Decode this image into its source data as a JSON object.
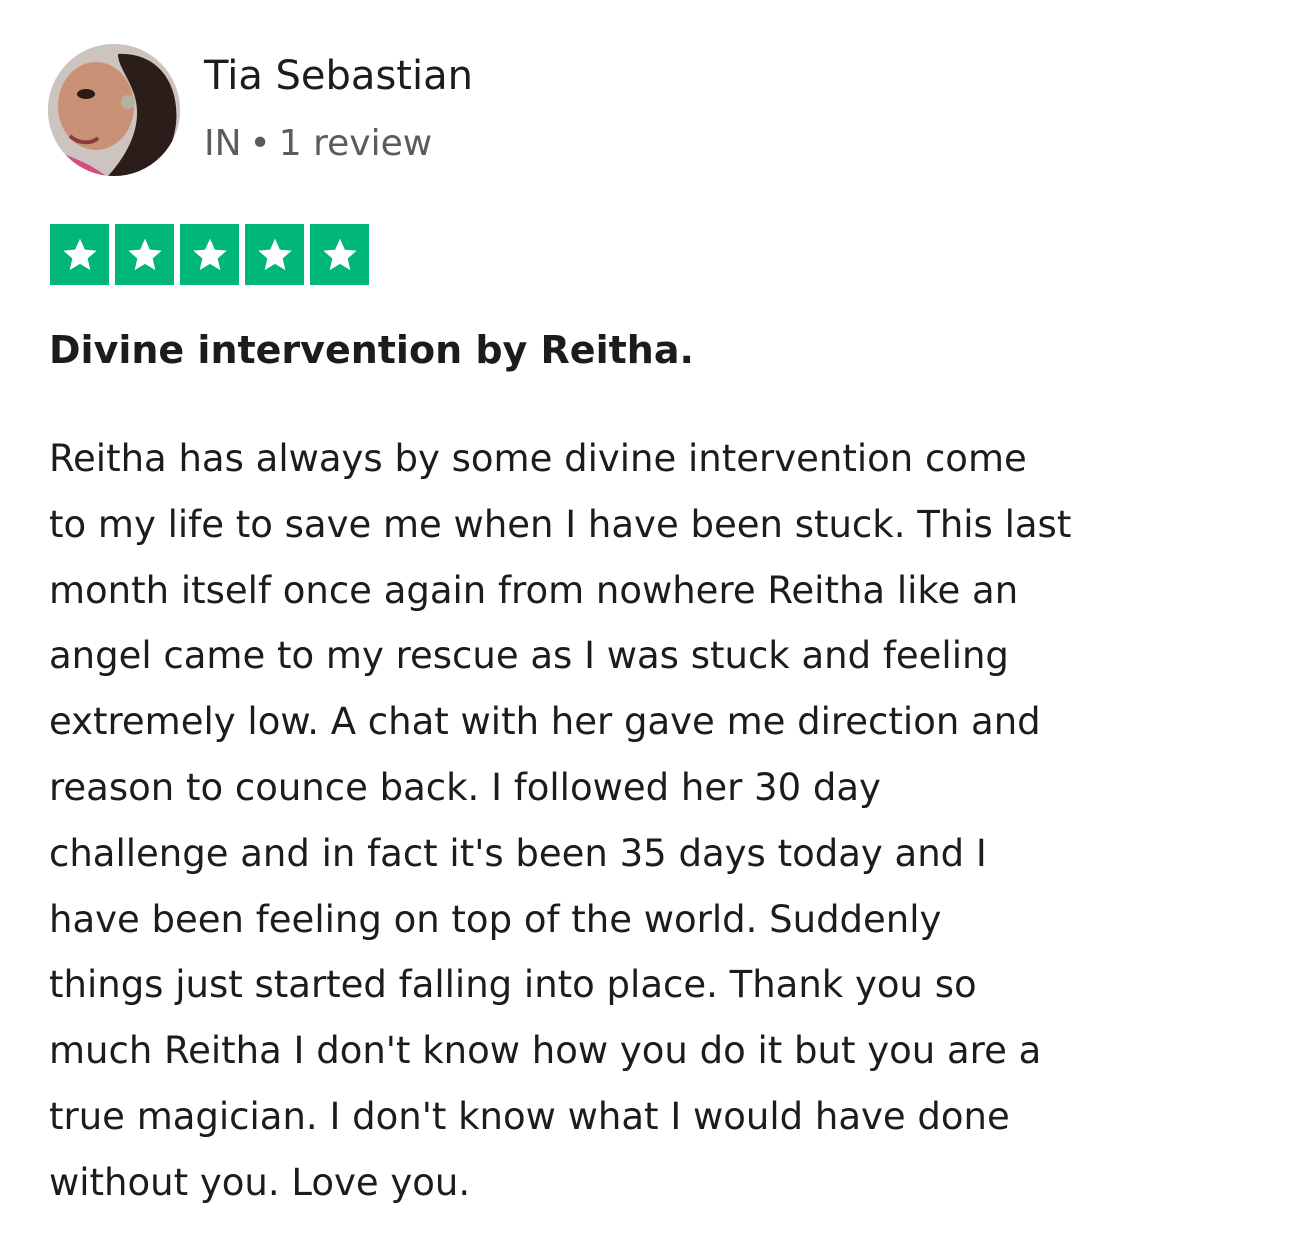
{
  "reviewer": {
    "name": "Tia Sebastian",
    "country": "IN",
    "separator": "•",
    "review_count": "1 review"
  },
  "rating": {
    "stars": 5,
    "max": 5,
    "color": "#00b67a",
    "icon": "star-icon"
  },
  "review": {
    "title": "Divine intervention by Reitha.",
    "lines": [
      "Reitha has always by some divine intervention come",
      "to my life to save me when I have been stuck. This last",
      "month itself once again from nowhere Reitha like an",
      "angel came to my rescue as I was stuck and feeling",
      "extremely low. A chat with her gave me direction and",
      "reason to counce back. I followed her 30 day",
      "challenge and in fact it's been 35 days today and I",
      "have been feeling on top of the world. Suddenly",
      "things just started falling into place. Thank you so",
      "much Reitha I don't know how you do it but you are a",
      "true magician. I don't know what I would have done",
      "without you. Love you."
    ]
  }
}
